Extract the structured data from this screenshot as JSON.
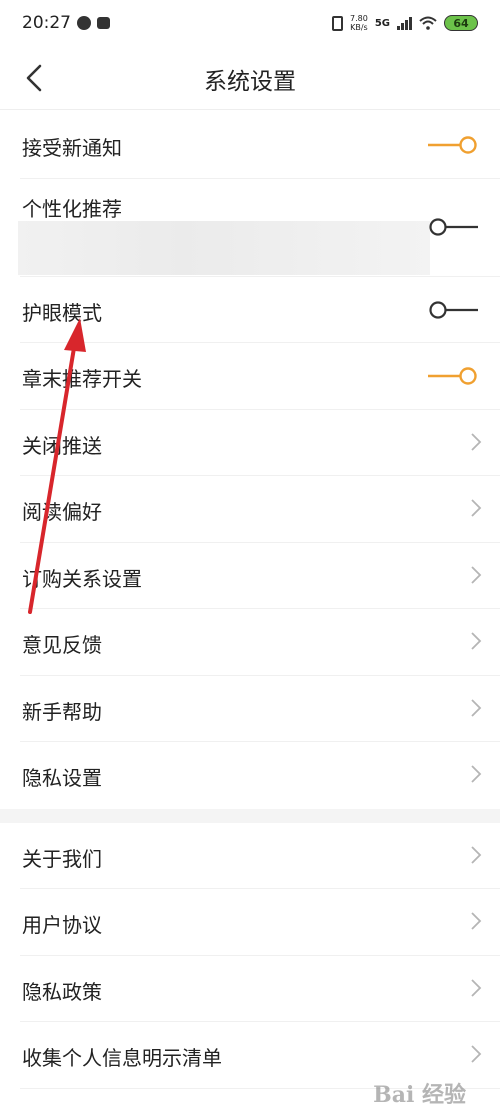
{
  "status": {
    "time": "20:27",
    "speed_top": "7.80",
    "speed_unit": "KB/s",
    "network": "5G",
    "battery": "64"
  },
  "header": {
    "title": "系统设置"
  },
  "items": [
    {
      "label": "接受新通知",
      "control": "toggle",
      "on": true
    },
    {
      "label": "个性化推荐",
      "control": "toggle",
      "on": false
    },
    {
      "label": "护眼模式",
      "control": "toggle",
      "on": false
    },
    {
      "label": "章末推荐开关",
      "control": "toggle",
      "on": true
    },
    {
      "label": "关闭推送",
      "control": "chevron"
    },
    {
      "label": "阅读偏好",
      "control": "chevron"
    },
    {
      "label": "订购关系设置",
      "control": "chevron"
    },
    {
      "label": "意见反馈",
      "control": "chevron"
    },
    {
      "label": "新手帮助",
      "control": "chevron"
    },
    {
      "label": "隐私设置",
      "control": "chevron"
    }
  ],
  "items2": [
    {
      "label": "关于我们",
      "control": "chevron"
    },
    {
      "label": "用户协议",
      "control": "chevron"
    },
    {
      "label": "隐私政策",
      "control": "chevron"
    },
    {
      "label": "收集个人信息明示清单",
      "control": "chevron"
    }
  ],
  "watermark": "Bai 经验",
  "colors": {
    "toggle_on": "#f0a030",
    "toggle_off": "#333333",
    "arrow": "#d8262c",
    "chevron": "#b5b5b5"
  }
}
